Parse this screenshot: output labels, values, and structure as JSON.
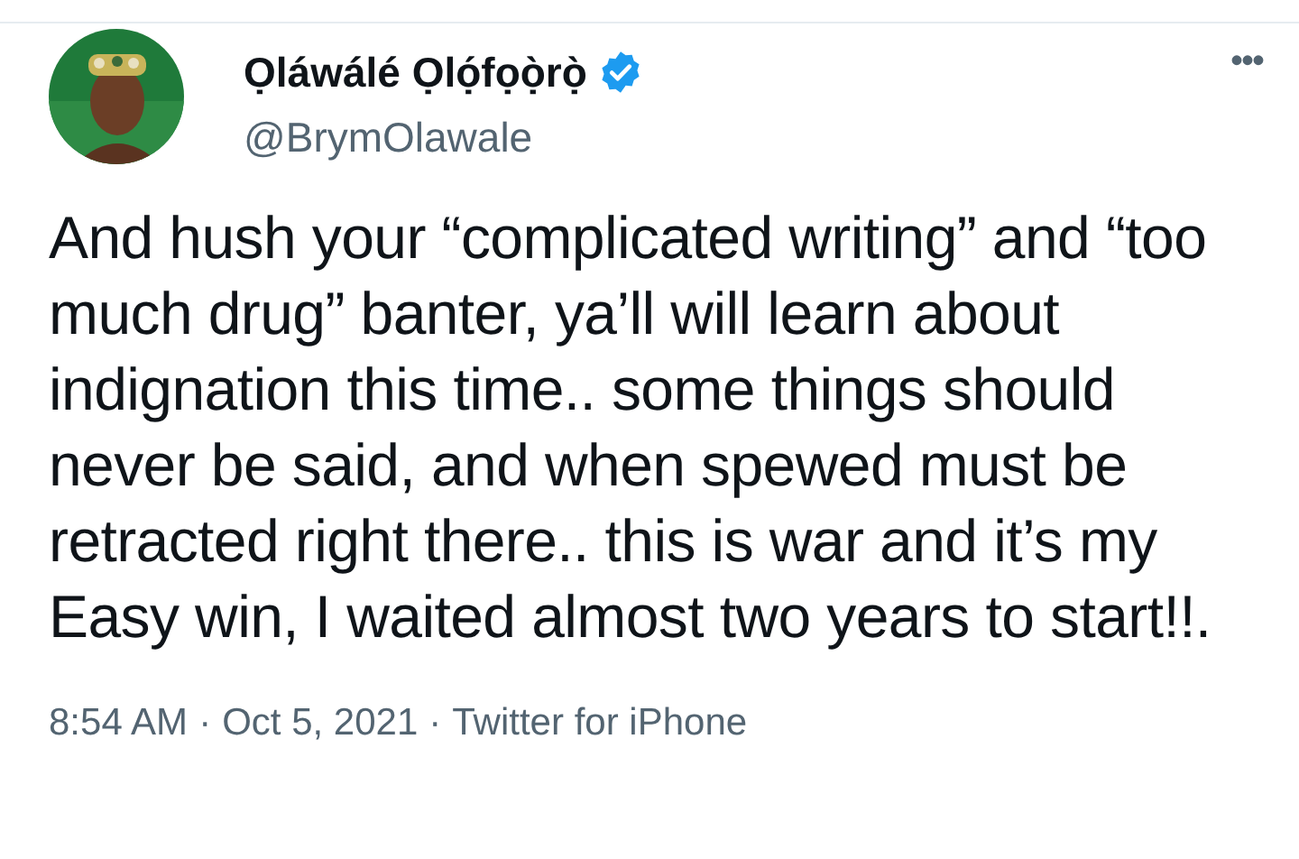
{
  "author": {
    "name": "Ọláwálé Ọlọ́fọọ̀rọ̀",
    "verified": true,
    "handle": "@BrymOlawale"
  },
  "menu": "•••",
  "tweet": {
    "text": "And hush your “complicated writing” and “too much drug” banter, ya’ll will learn about indignation this time.. some things should never be said, and when spewed must be retracted right there.. this is war and it’s my Easy win, I waited almost two years to start!!."
  },
  "meta": {
    "time": "8:54 AM",
    "separator_1": "·",
    "date": "Oct 5, 2021",
    "separator_2": "·",
    "source": "Twitter for iPhone"
  }
}
